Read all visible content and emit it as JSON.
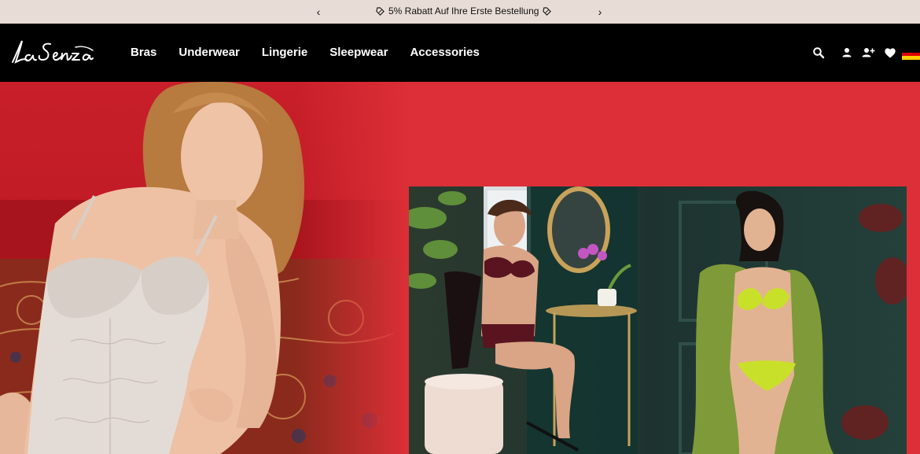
{
  "announcement": {
    "prev_label": "‹",
    "next_label": "›",
    "message": "5% Rabatt Auf Ihre Erste Bestellung"
  },
  "header": {
    "logo_text": "La Senza",
    "nav": [
      {
        "label": "Bras"
      },
      {
        "label": "Underwear"
      },
      {
        "label": "Lingerie"
      },
      {
        "label": "Sleepwear"
      },
      {
        "label": "Accessories"
      }
    ],
    "icons": [
      "search-icon",
      "account-icon",
      "add-account-icon",
      "wishlist-heart-icon",
      "germany-flag-icon"
    ]
  },
  "colors": {
    "announce_bg": "#e8ddd6",
    "header_bg": "#000000",
    "hero_red": "#dc2f37"
  }
}
